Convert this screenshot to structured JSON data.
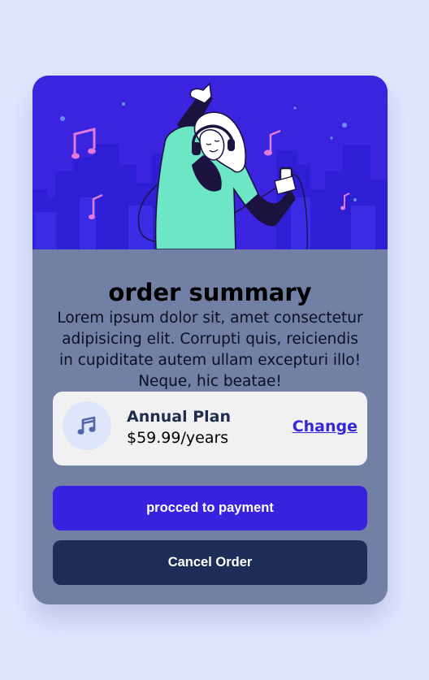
{
  "card": {
    "title": "order summary",
    "description": "Lorem ipsum dolor sit, amet consectetur adipisicing elit. Corrupti quis, reiciendis in cupiditate autem ullam excepturi illo! Neque, hic beatae!"
  },
  "plan": {
    "icon": "music-note-icon",
    "name": "Annual Plan",
    "price": "$59.99/years",
    "change_label": "Change"
  },
  "buttons": {
    "payment_label": "procced to payment",
    "cancel_label": "Cancel Order"
  },
  "colors": {
    "page_background": "#e0e6fe",
    "hero_background": "#3a24df",
    "card_body": "#7280a6",
    "primary_button": "#3822e0",
    "cancel_button": "#1e2d56",
    "link": "#3527d6",
    "plan_box": "#f1f1f1"
  }
}
